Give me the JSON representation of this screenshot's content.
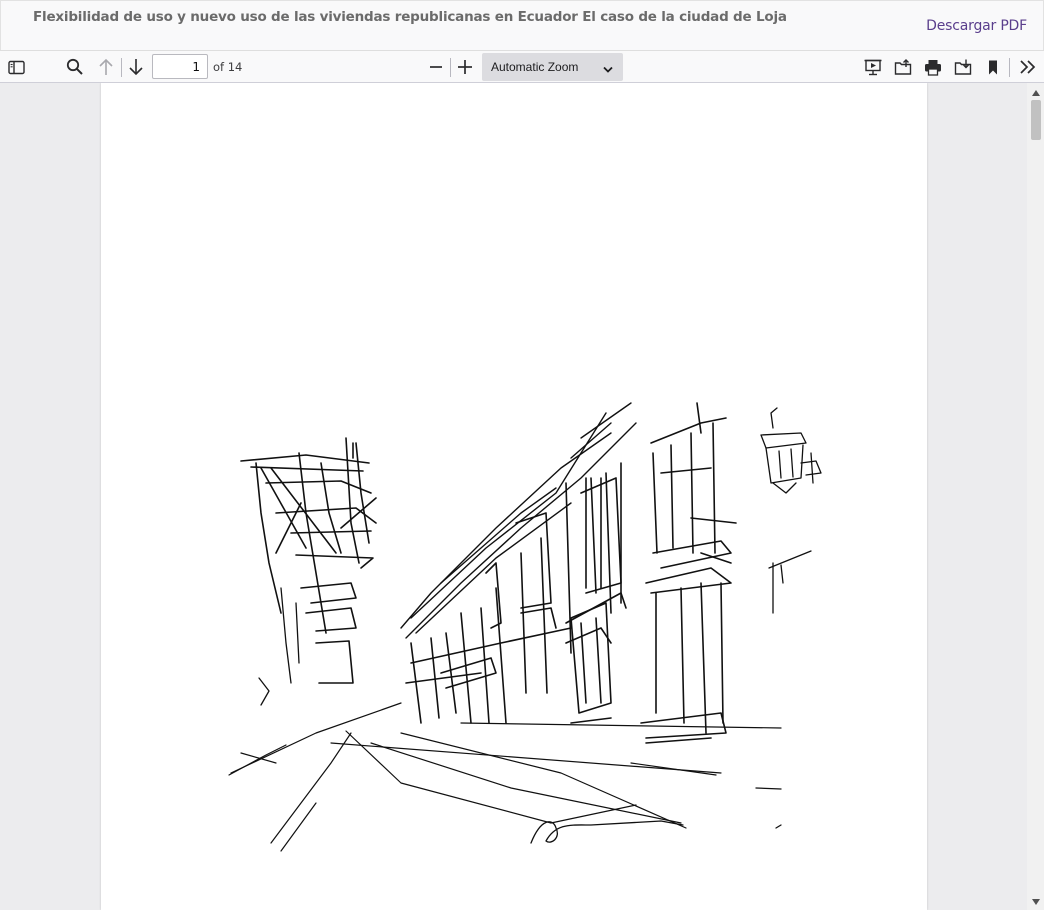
{
  "header": {
    "title": "Flexibilidad de uso y nuevo uso de las viviendas republicanas en Ecuador El caso de la ciudad de Loja",
    "download_label": "Descargar PDF"
  },
  "toolbar": {
    "sidebar_toggle_icon": "sidebar-icon",
    "find_icon": "search-icon",
    "previous_icon": "arrow-up-icon",
    "next_icon": "arrow-down-icon",
    "page_number": "1",
    "page_count": "of 14",
    "zoom_out_icon": "minus-icon",
    "zoom_in_icon": "plus-icon",
    "zoom_value": "Automatic Zoom",
    "presentation_icon": "presentation-icon",
    "open_file_icon": "open-file-icon",
    "print_icon": "print-icon",
    "save_icon": "download-icon",
    "bookmark_icon": "bookmark-icon",
    "tools_icon": "double-chevron-right-icon"
  },
  "document": {
    "current_page": 1,
    "total_pages": 14,
    "page_content": "ink-sketch-illustration"
  },
  "colors": {
    "link": "#5a3e8c",
    "toolbar_bg": "#f9f9fa",
    "viewer_bg": "#ececee",
    "zoom_bg": "#dcdce0"
  }
}
